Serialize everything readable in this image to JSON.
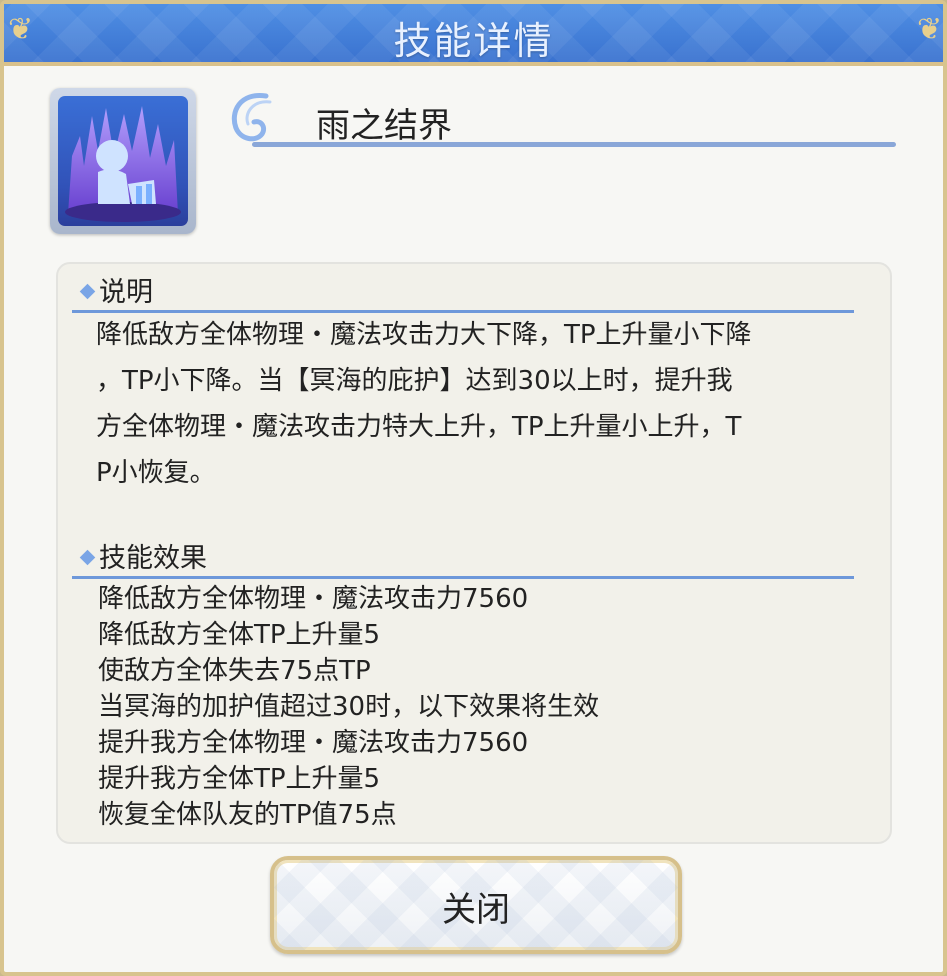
{
  "header": {
    "title": "技能详情"
  },
  "skill": {
    "name": "雨之结界",
    "icon": "skill-icon"
  },
  "description": {
    "heading": "说明",
    "lines": [
      "降低敌方全体物理・魔法攻击力大下降，TP上升量小下降",
      "，TP小下降。当【冥海的庇护】达到30以上时，提升我",
      "方全体物理・魔法攻击力特大上升，TP上升量小上升，T",
      "P小恢复。"
    ]
  },
  "effects": {
    "heading": "技能效果",
    "lines": [
      "降低敌方全体物理・魔法攻击力7560",
      "降低敌方全体TP上升量5",
      "使敌方全体失去75点TP",
      "当冥海的加护值超过30时，以下效果将生效",
      "提升我方全体物理・魔法攻击力7560",
      "提升我方全体TP上升量5",
      "恢复全体队友的TP值75点"
    ]
  },
  "footer": {
    "close_label": "关闭"
  },
  "colors": {
    "header_blue": "#3f7fdc",
    "accent_blue": "#6e98da",
    "gold_border": "#d6c08b"
  }
}
